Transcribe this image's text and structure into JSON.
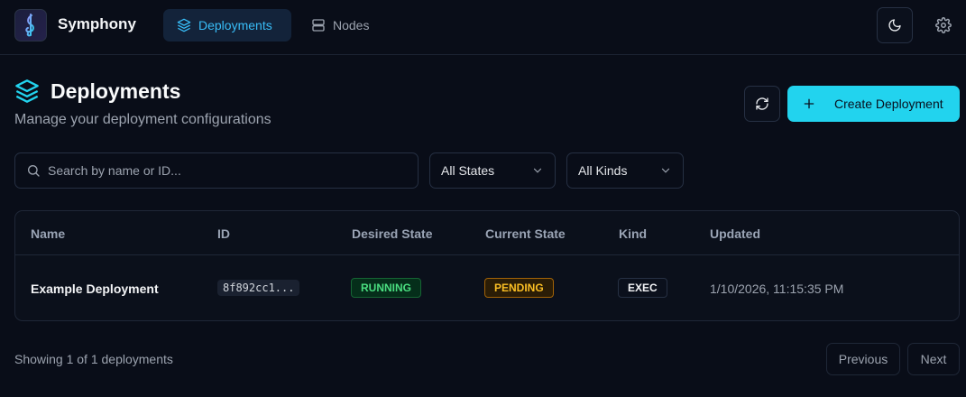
{
  "app": {
    "name": "Symphony",
    "logo_icon": "music-clef-icon"
  },
  "nav": {
    "tabs": [
      {
        "label": "Deployments",
        "icon": "layers-icon",
        "active": true
      },
      {
        "label": "Nodes",
        "icon": "server-icon",
        "active": false
      }
    ],
    "theme_icon": "moon-icon",
    "settings_icon": "gear-icon"
  },
  "header": {
    "title": "Deployments",
    "subtitle": "Manage your deployment configurations",
    "icon": "layers-icon"
  },
  "actions": {
    "refresh_icon": "refresh-icon",
    "create_label": "Create Deployment",
    "create_icon": "plus-icon"
  },
  "filters": {
    "search_placeholder": "Search by name or ID...",
    "state_value": "All States",
    "kind_value": "All Kinds"
  },
  "table": {
    "columns": [
      "Name",
      "ID",
      "Desired State",
      "Current State",
      "Kind",
      "Updated"
    ],
    "rows": [
      {
        "name": "Example Deployment",
        "id": "8f892cc1...",
        "desired_state": "RUNNING",
        "current_state": "PENDING",
        "kind": "EXEC",
        "updated": "1/10/2026, 11:15:35 PM"
      }
    ]
  },
  "footer": {
    "showing": "Showing 1 of 1 deployments",
    "previous": "Previous",
    "next": "Next"
  },
  "colors": {
    "background": "#090d18",
    "accent": "#22d3ee",
    "running": "#4ade80",
    "pending": "#fbbf24"
  }
}
